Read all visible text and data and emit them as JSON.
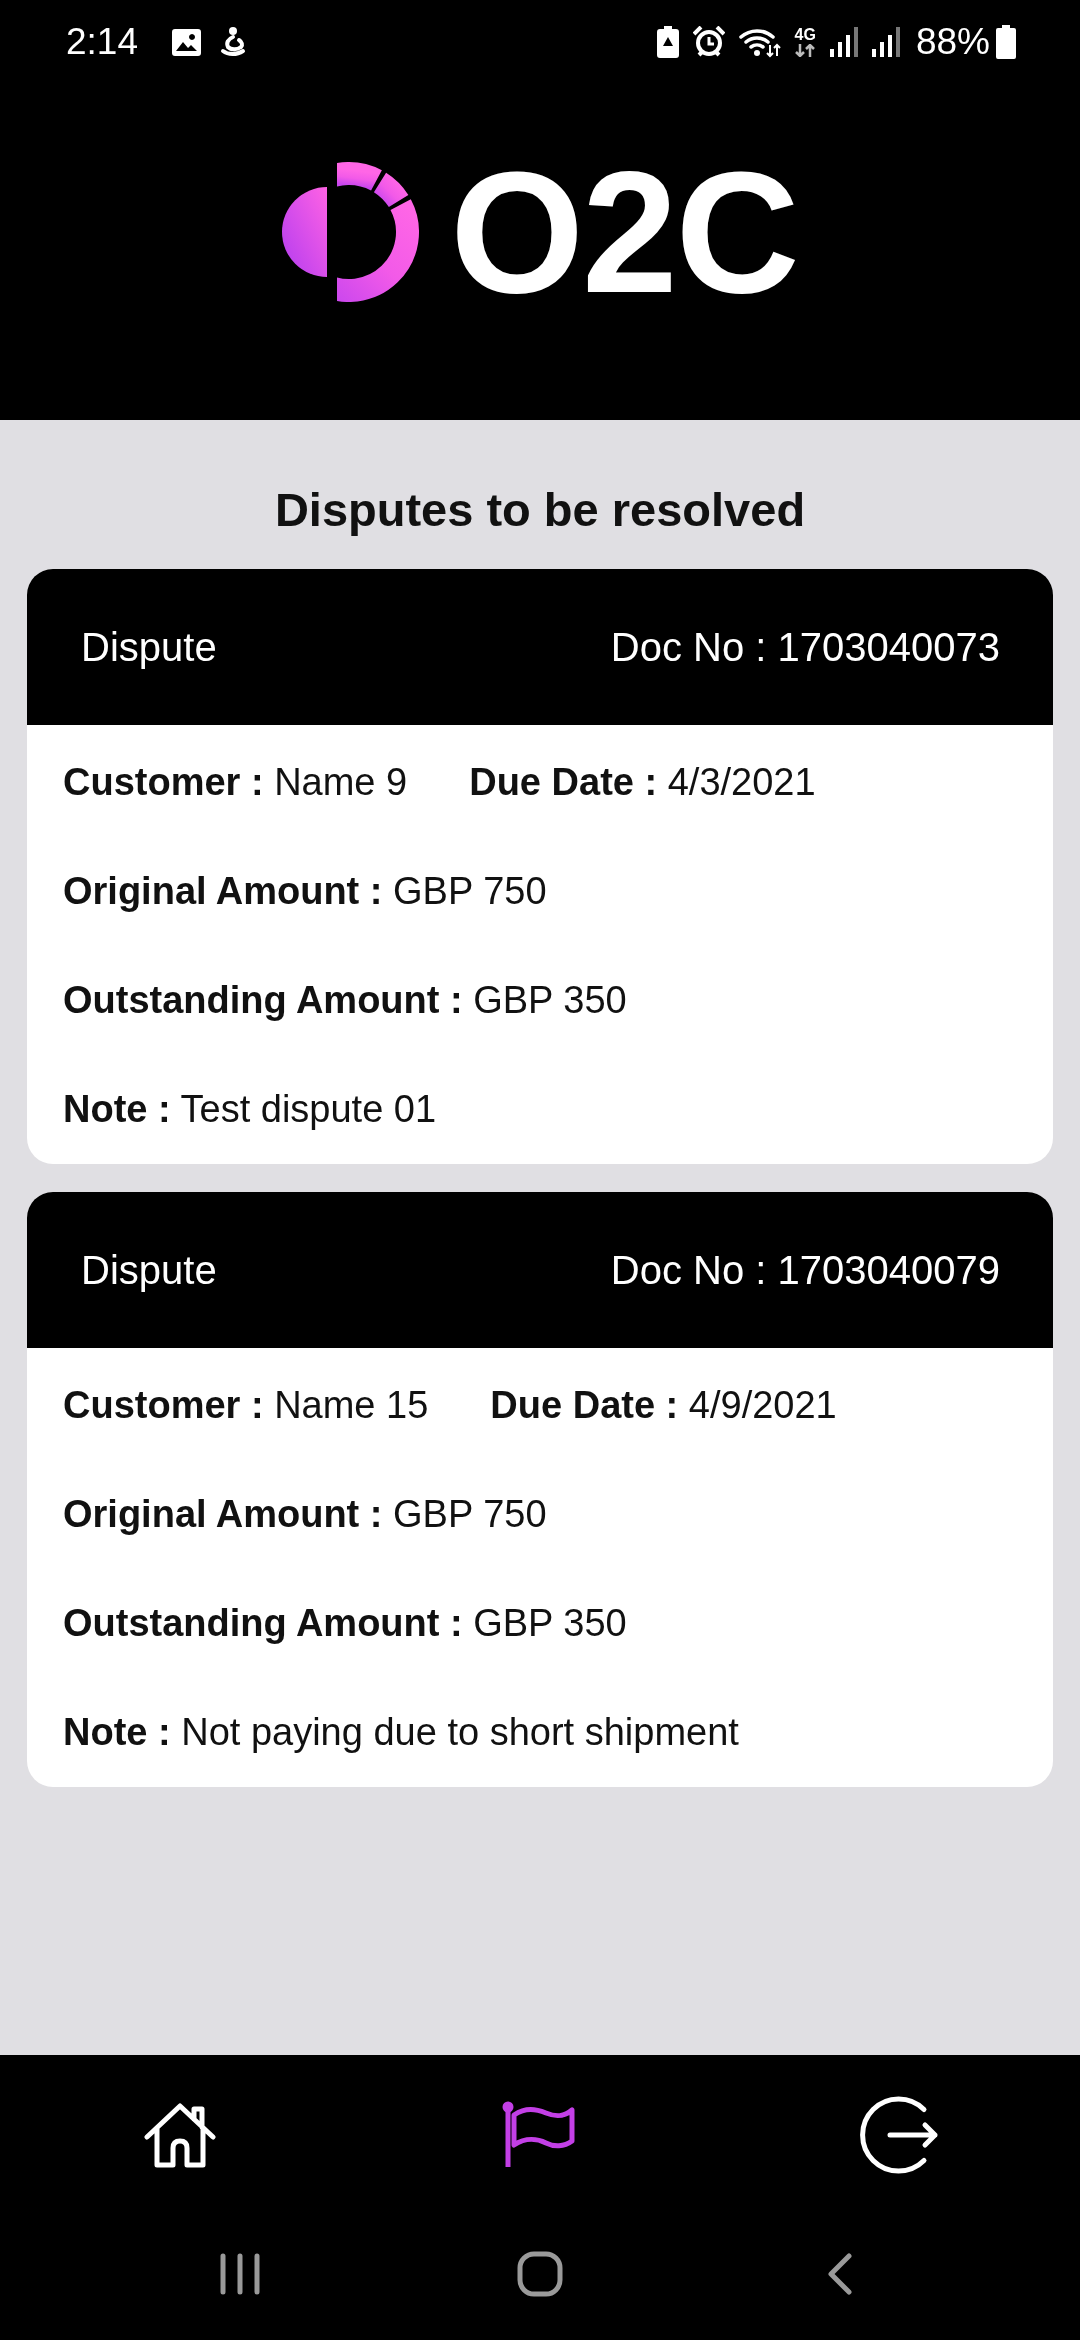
{
  "status_bar": {
    "time": "2:14",
    "network_type": "4G",
    "battery_percent": "88%"
  },
  "header": {
    "logo_text": "O2C"
  },
  "page_title": "Disputes to be resolved",
  "disputes": [
    {
      "title": "Dispute",
      "doc_no": "Doc No : 1703040073",
      "rows": [
        {
          "fields": [
            {
              "label": "Customer :",
              "value": "Name 9"
            },
            {
              "label": "Due Date :",
              "value": "4/3/2021"
            }
          ]
        },
        {
          "fields": [
            {
              "label": "Original Amount :",
              "value": "GBP 750"
            }
          ]
        },
        {
          "fields": [
            {
              "label": "Outstanding Amount :",
              "value": "GBP 350"
            }
          ]
        },
        {
          "fields": [
            {
              "label": "Note :",
              "value": "Test dispute 01"
            }
          ]
        }
      ]
    },
    {
      "title": "Dispute",
      "doc_no": "Doc No : 1703040079",
      "rows": [
        {
          "fields": [
            {
              "label": "Customer :",
              "value": "Name 15"
            },
            {
              "label": "Due Date :",
              "value": "4/9/2021"
            }
          ]
        },
        {
          "fields": [
            {
              "label": "Original Amount :",
              "value": "GBP 750"
            }
          ]
        },
        {
          "fields": [
            {
              "label": "Outstanding Amount :",
              "value": "GBP 350"
            }
          ]
        },
        {
          "fields": [
            {
              "label": "Note :",
              "value": "Not paying due to short shipment"
            }
          ]
        }
      ]
    }
  ],
  "bottom_nav": {
    "items": [
      {
        "kind": "home",
        "selected": false
      },
      {
        "kind": "disputes",
        "selected": true
      },
      {
        "kind": "logout",
        "selected": false
      }
    ]
  }
}
